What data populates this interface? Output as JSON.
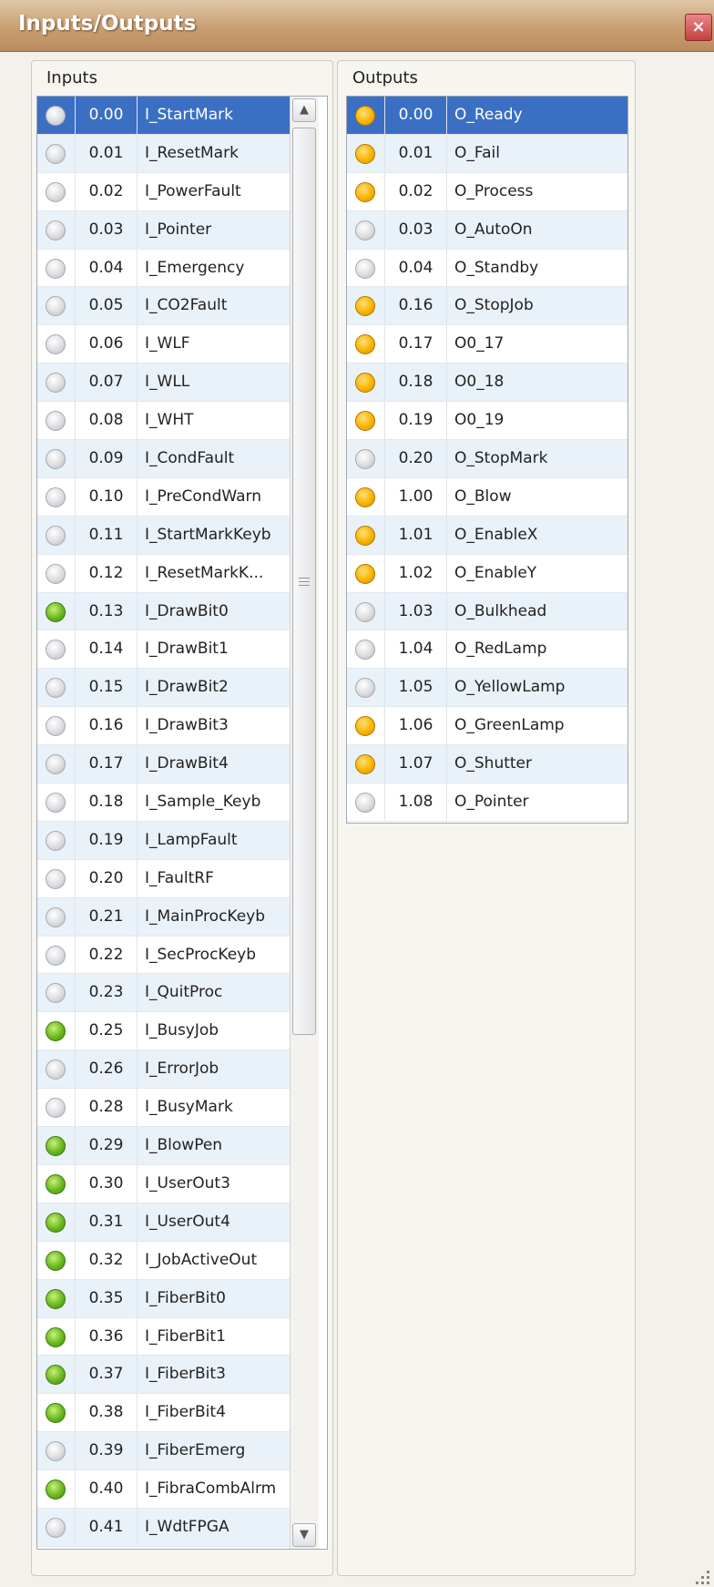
{
  "window": {
    "title": "Inputs/Outputs",
    "close_label": "×"
  },
  "colors": {
    "selected_row": "#3a6fc4",
    "alt_row": "#eaf2f9",
    "led_off": "#dcdde0",
    "led_green": "#69b81e",
    "led_yellow": "#f8b400"
  },
  "inputs": {
    "label": "Inputs",
    "scroll_up_icon": "▲",
    "scroll_down_icon": "▼",
    "rows": [
      {
        "addr": "0.00",
        "name": "I_StartMark",
        "state": "off",
        "selected": true
      },
      {
        "addr": "0.01",
        "name": "I_ResetMark",
        "state": "off"
      },
      {
        "addr": "0.02",
        "name": "I_PowerFault",
        "state": "off"
      },
      {
        "addr": "0.03",
        "name": "I_Pointer",
        "state": "off"
      },
      {
        "addr": "0.04",
        "name": "I_Emergency",
        "state": "off"
      },
      {
        "addr": "0.05",
        "name": "I_CO2Fault",
        "state": "off"
      },
      {
        "addr": "0.06",
        "name": "I_WLF",
        "state": "off"
      },
      {
        "addr": "0.07",
        "name": "I_WLL",
        "state": "off"
      },
      {
        "addr": "0.08",
        "name": "I_WHT",
        "state": "off"
      },
      {
        "addr": "0.09",
        "name": "I_CondFault",
        "state": "off"
      },
      {
        "addr": "0.10",
        "name": "I_PreCondWarn",
        "state": "off"
      },
      {
        "addr": "0.11",
        "name": "I_StartMarkKeyb",
        "state": "off"
      },
      {
        "addr": "0.12",
        "name": "I_ResetMarkK...",
        "state": "off"
      },
      {
        "addr": "0.13",
        "name": "I_DrawBit0",
        "state": "green"
      },
      {
        "addr": "0.14",
        "name": "I_DrawBit1",
        "state": "off"
      },
      {
        "addr": "0.15",
        "name": "I_DrawBit2",
        "state": "off"
      },
      {
        "addr": "0.16",
        "name": "I_DrawBit3",
        "state": "off"
      },
      {
        "addr": "0.17",
        "name": "I_DrawBit4",
        "state": "off"
      },
      {
        "addr": "0.18",
        "name": "I_Sample_Keyb",
        "state": "off"
      },
      {
        "addr": "0.19",
        "name": "I_LampFault",
        "state": "off"
      },
      {
        "addr": "0.20",
        "name": "I_FaultRF",
        "state": "off"
      },
      {
        "addr": "0.21",
        "name": "I_MainProcKeyb",
        "state": "off"
      },
      {
        "addr": "0.22",
        "name": "I_SecProcKeyb",
        "state": "off"
      },
      {
        "addr": "0.23",
        "name": "I_QuitProc",
        "state": "off"
      },
      {
        "addr": "0.25",
        "name": "I_BusyJob",
        "state": "green"
      },
      {
        "addr": "0.26",
        "name": "I_ErrorJob",
        "state": "off"
      },
      {
        "addr": "0.28",
        "name": "I_BusyMark",
        "state": "off"
      },
      {
        "addr": "0.29",
        "name": "I_BlowPen",
        "state": "green"
      },
      {
        "addr": "0.30",
        "name": "I_UserOut3",
        "state": "green"
      },
      {
        "addr": "0.31",
        "name": "I_UserOut4",
        "state": "green"
      },
      {
        "addr": "0.32",
        "name": "I_JobActiveOut",
        "state": "green"
      },
      {
        "addr": "0.35",
        "name": "I_FiberBit0",
        "state": "green"
      },
      {
        "addr": "0.36",
        "name": "I_FiberBit1",
        "state": "green"
      },
      {
        "addr": "0.37",
        "name": "I_FiberBit3",
        "state": "green"
      },
      {
        "addr": "0.38",
        "name": "I_FiberBit4",
        "state": "green"
      },
      {
        "addr": "0.39",
        "name": "I_FiberEmerg",
        "state": "off"
      },
      {
        "addr": "0.40",
        "name": "I_FibraCombAlrm",
        "state": "green"
      },
      {
        "addr": "0.41",
        "name": "I_WdtFPGA",
        "state": "off"
      }
    ]
  },
  "outputs": {
    "label": "Outputs",
    "rows": [
      {
        "addr": "0.00",
        "name": "O_Ready",
        "state": "yellow",
        "selected": true
      },
      {
        "addr": "0.01",
        "name": "O_Fail",
        "state": "yellow"
      },
      {
        "addr": "0.02",
        "name": "O_Process",
        "state": "yellow"
      },
      {
        "addr": "0.03",
        "name": "O_AutoOn",
        "state": "off"
      },
      {
        "addr": "0.04",
        "name": "O_Standby",
        "state": "off"
      },
      {
        "addr": "0.16",
        "name": "O_StopJob",
        "state": "yellow"
      },
      {
        "addr": "0.17",
        "name": "O0_17",
        "state": "yellow"
      },
      {
        "addr": "0.18",
        "name": "O0_18",
        "state": "yellow"
      },
      {
        "addr": "0.19",
        "name": "O0_19",
        "state": "yellow"
      },
      {
        "addr": "0.20",
        "name": "O_StopMark",
        "state": "off"
      },
      {
        "addr": "1.00",
        "name": "O_Blow",
        "state": "yellow"
      },
      {
        "addr": "1.01",
        "name": "O_EnableX",
        "state": "yellow"
      },
      {
        "addr": "1.02",
        "name": "O_EnableY",
        "state": "yellow"
      },
      {
        "addr": "1.03",
        "name": "O_Bulkhead",
        "state": "off"
      },
      {
        "addr": "1.04",
        "name": "O_RedLamp",
        "state": "off"
      },
      {
        "addr": "1.05",
        "name": "O_YellowLamp",
        "state": "off"
      },
      {
        "addr": "1.06",
        "name": "O_GreenLamp",
        "state": "yellow"
      },
      {
        "addr": "1.07",
        "name": "O_Shutter",
        "state": "yellow"
      },
      {
        "addr": "1.08",
        "name": "O_Pointer",
        "state": "off"
      }
    ]
  }
}
